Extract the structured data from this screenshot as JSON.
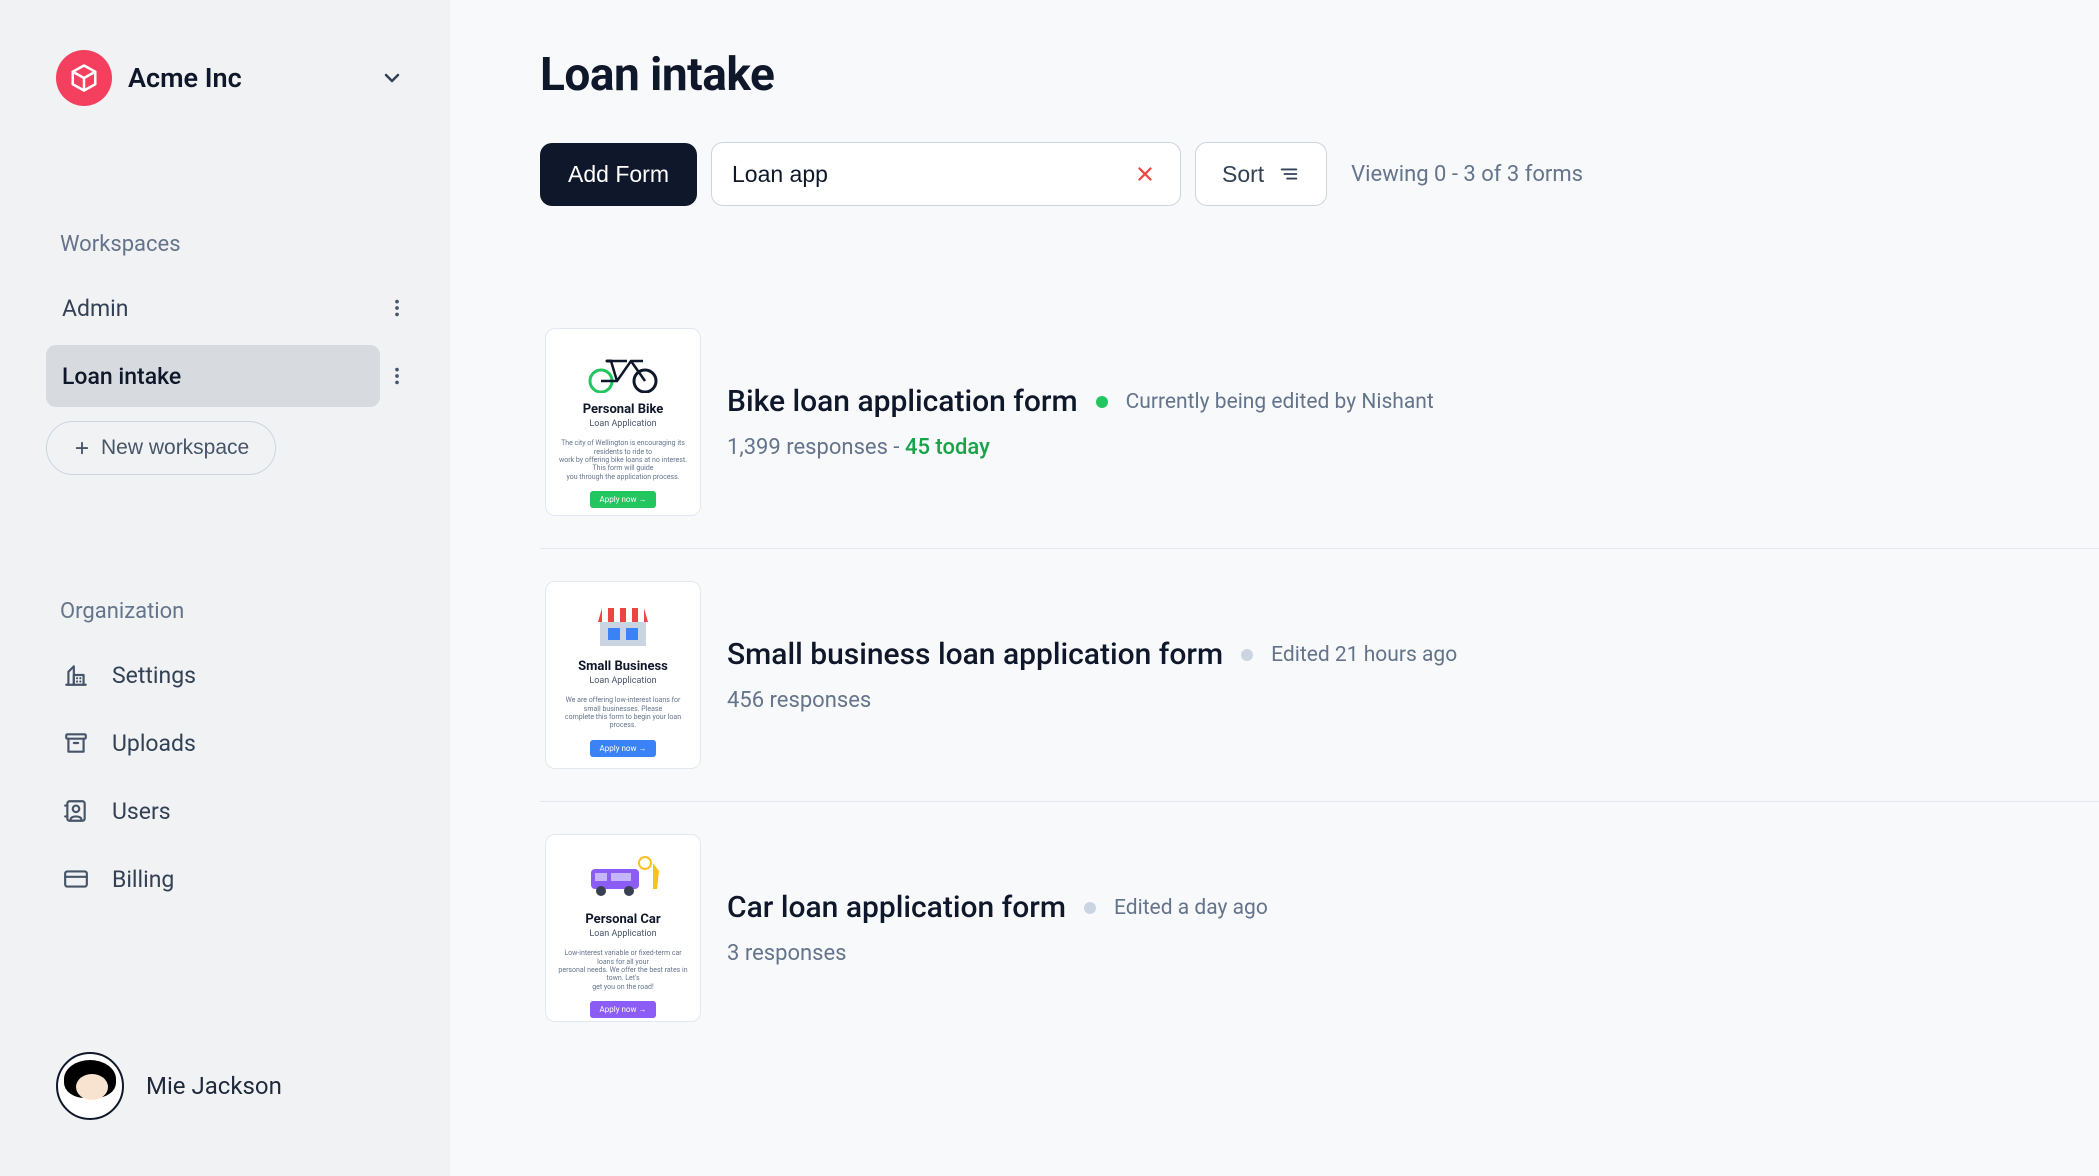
{
  "sidebar": {
    "org_name": "Acme Inc",
    "workspaces_label": "Workspaces",
    "workspaces": [
      {
        "label": "Admin",
        "active": false
      },
      {
        "label": "Loan intake",
        "active": true
      }
    ],
    "new_workspace_label": "New workspace",
    "organization_label": "Organization",
    "org_nav": {
      "settings": "Settings",
      "uploads": "Uploads",
      "users": "Users",
      "billing": "Billing"
    },
    "user_name": "Mie Jackson"
  },
  "main": {
    "title": "Loan intake",
    "add_form_label": "Add Form",
    "search_value": "Loan app",
    "sort_label": "Sort",
    "viewing_text": "Viewing 0 - 3 of 3 forms"
  },
  "forms": [
    {
      "title": "Bike loan application form",
      "status_color": "green",
      "status_text": "Currently being edited by Nishant",
      "responses": "1,399 responses",
      "sep": " - ",
      "today": "45 today",
      "thumb": {
        "title": "Personal Bike",
        "sub": "Loan Application",
        "btn": "Apply now →",
        "btn_color": "green",
        "illus": "bike"
      }
    },
    {
      "title": "Small business loan application form",
      "status_color": "gray",
      "status_text": "Edited 21 hours ago",
      "responses": "456 responses",
      "sep": "",
      "today": "",
      "thumb": {
        "title": "Small Business",
        "sub": "Loan Application",
        "btn": "Apply now →",
        "btn_color": "blue",
        "illus": "store"
      }
    },
    {
      "title": "Car loan application form",
      "status_color": "gray",
      "status_text": "Edited a day ago",
      "responses": "3 responses",
      "sep": "",
      "today": "",
      "thumb": {
        "title": "Personal Car",
        "sub": "Loan Application",
        "btn": "Apply now →",
        "btn_color": "purple",
        "illus": "van"
      }
    }
  ]
}
